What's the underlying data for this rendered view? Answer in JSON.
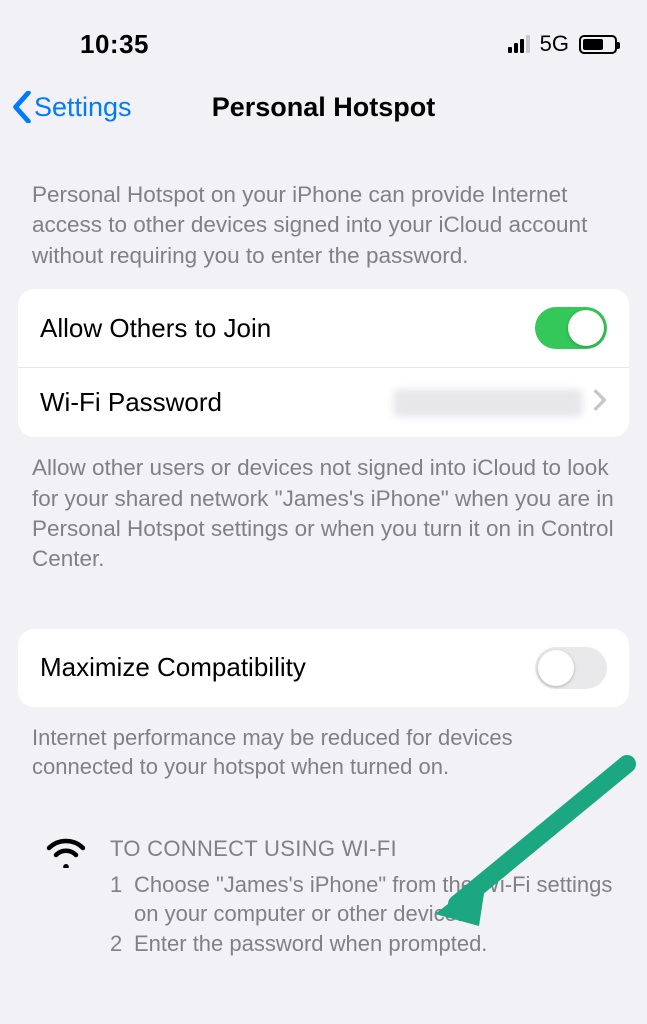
{
  "status": {
    "time": "10:35",
    "network_type": "5G"
  },
  "nav": {
    "back_label": "Settings",
    "title": "Personal Hotspot"
  },
  "intro_desc": "Personal Hotspot on your iPhone can provide Internet access to other devices signed into your iCloud account without requiring you to enter the password.",
  "rows": {
    "allow_others": {
      "label": "Allow Others to Join",
      "on": true
    },
    "wifi_password": {
      "label": "Wi-Fi Password",
      "value_hidden": true
    }
  },
  "allow_desc": "Allow other users or devices not signed into iCloud to look for your shared network \"James's iPhone\" when you are in Personal Hotspot settings or when you turn it on in Control Center.",
  "max_compat": {
    "label": "Maximize Compatibility",
    "on": false
  },
  "compat_desc": "Internet performance may be reduced for devices connected to your hotspot when turned on.",
  "connect": {
    "title": "TO CONNECT USING WI-FI",
    "step1_num": "1",
    "step1_text": "Choose \"James's iPhone\" from the Wi-Fi settings on your computer or other device.",
    "step2_num": "2",
    "step2_text": "Enter the password when prompted."
  }
}
